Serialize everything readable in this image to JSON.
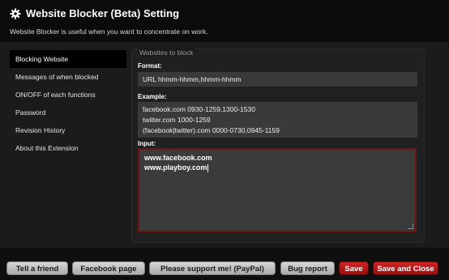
{
  "header": {
    "title": "Website Blocker (Beta) Setting",
    "subtitle": "Website Blocker is useful when you want to concentrate on work."
  },
  "sidebar": {
    "items": [
      {
        "label": "Blocking Website",
        "active": true
      },
      {
        "label": "Messages of when blocked",
        "active": false
      },
      {
        "label": "ON/OFF of each functions",
        "active": false
      },
      {
        "label": "Password",
        "active": false
      },
      {
        "label": "Revision History",
        "active": false
      },
      {
        "label": "About this Extension",
        "active": false
      }
    ]
  },
  "main": {
    "section_title": "Websites to block",
    "format_label": "Format:",
    "format_value": "URL hhmm-hhmm,hhmm-hhmm",
    "example_label": "Example:",
    "example_lines": [
      "facebook.com 0930-1259,1300-1530",
      "twitter.com 1000-1259",
      "(facebook|twitter).com 0000-0730,0945-1159"
    ],
    "input_label": "Input:",
    "input_lines": [
      "www.facebook.com",
      "www.playboy.com"
    ]
  },
  "footer": {
    "buttons": [
      {
        "label": "Tell a friend",
        "style": "gray"
      },
      {
        "label": "Facebook page",
        "style": "gray"
      },
      {
        "label": "Please support me! (PayPal)",
        "style": "gray"
      },
      {
        "label": "Bug report",
        "style": "gray"
      },
      {
        "label": "Save",
        "style": "red"
      },
      {
        "label": "Save and Close",
        "style": "red"
      }
    ]
  },
  "colors": {
    "background": "#0f0f0f",
    "content_bg": "#1b1b1b",
    "field_bg": "#3a3a3a",
    "input_border": "#6e1414",
    "button_red": "#c41e1e",
    "button_gray": "#c2c2c2"
  }
}
